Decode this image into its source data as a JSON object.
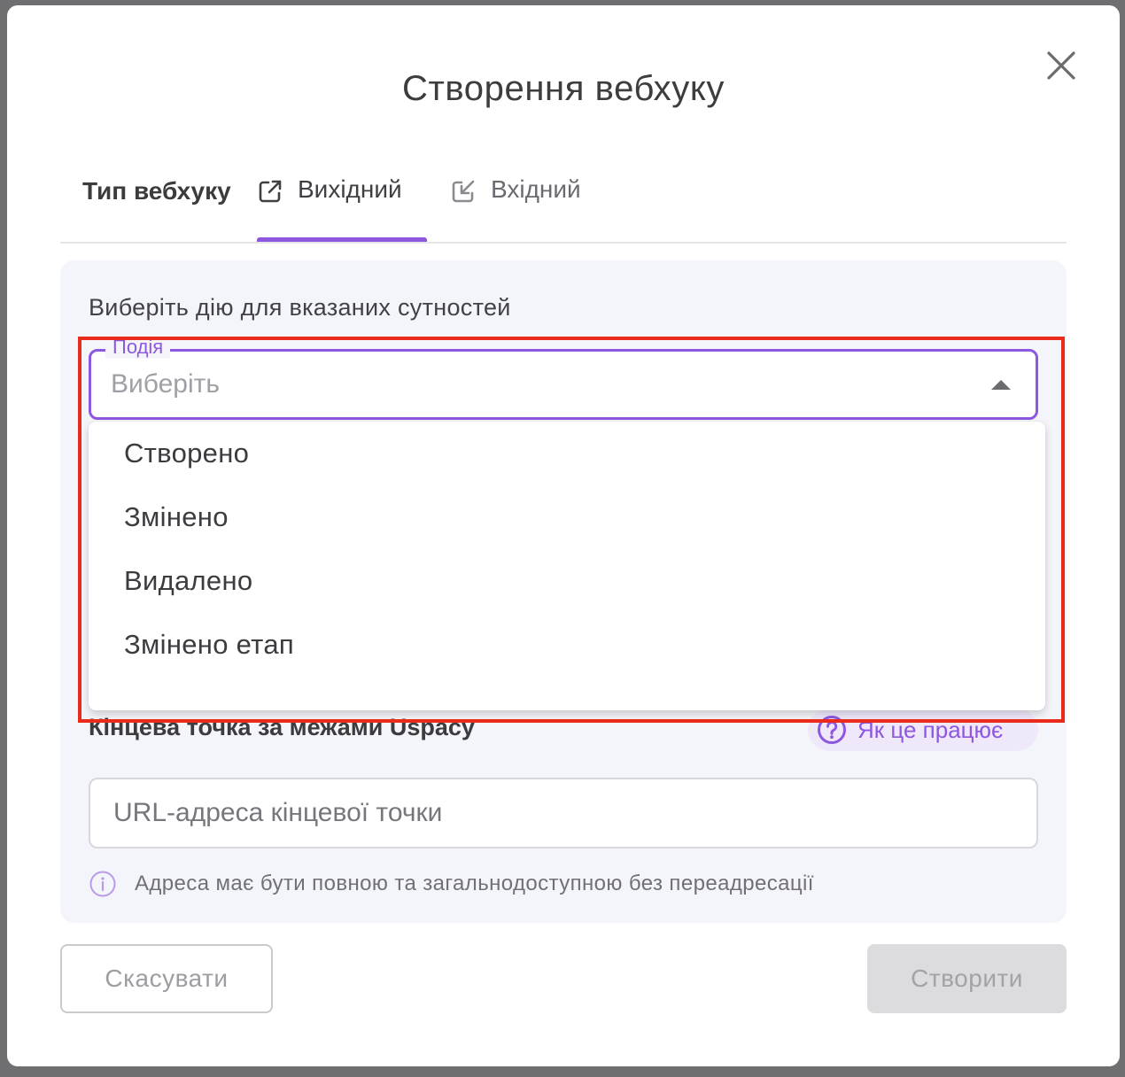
{
  "modal": {
    "title": "Створення вебхуку"
  },
  "tabs": {
    "label": "Тип вебхуку",
    "items": [
      {
        "label": "Вихідний",
        "icon": "external-link-icon",
        "active": true
      },
      {
        "label": "Вхідний",
        "icon": "incoming-arrow-icon",
        "active": false
      }
    ]
  },
  "event_section": {
    "heading": "Виберіть дію для вказаних сутностей",
    "select": {
      "legend": "Подія",
      "placeholder": "Виберіть"
    },
    "options": [
      "Створено",
      "Змінено",
      "Видалено",
      "Змінено етап"
    ]
  },
  "endpoint": {
    "heading": "Кінцева точка за межами Uspacy",
    "help_label": "Як це працює",
    "input_placeholder": "URL-адреса кінцевої точки",
    "hint": "Адреса має бути повною та загальнодоступною без переадресації"
  },
  "footer": {
    "cancel_label": "Скасувати",
    "create_label": "Створити"
  },
  "colors": {
    "accent": "#8d57e0",
    "highlight": "#ea2a1a"
  }
}
